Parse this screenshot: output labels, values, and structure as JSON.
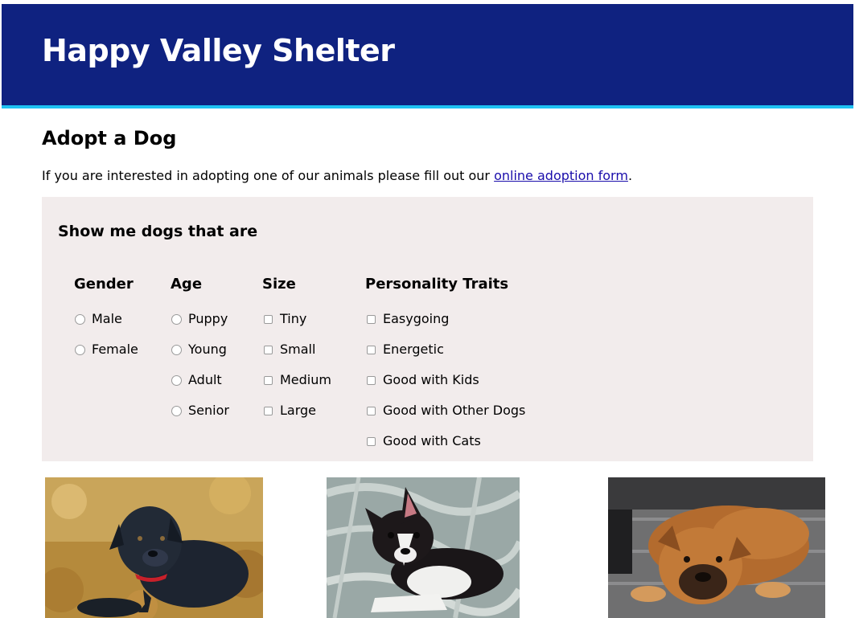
{
  "header": {
    "title": "Happy Valley Shelter"
  },
  "main": {
    "heading": "Adopt a Dog",
    "intro_text": "If you are interested in adopting one of our animals please fill out our ",
    "intro_link": "online adoption form",
    "intro_end": "."
  },
  "filters": {
    "heading": "Show me dogs that are",
    "gender": {
      "title": "Gender",
      "options": [
        "Male",
        "Female"
      ]
    },
    "age": {
      "title": "Age",
      "options": [
        "Puppy",
        "Young",
        "Adult",
        "Senior"
      ]
    },
    "size": {
      "title": "Size",
      "options": [
        "Tiny",
        "Small",
        "Medium",
        "Large"
      ]
    },
    "traits": {
      "title": "Personality Traits",
      "options": [
        "Easygoing",
        "Energetic",
        "Good with Kids",
        "Good with Other Dogs",
        "Good with Cats"
      ]
    }
  },
  "colors": {
    "header_bg": "#0f2280",
    "header_accent": "#1fc2f2",
    "panel_bg": "#f2ecec",
    "link": "#1a0dab"
  }
}
